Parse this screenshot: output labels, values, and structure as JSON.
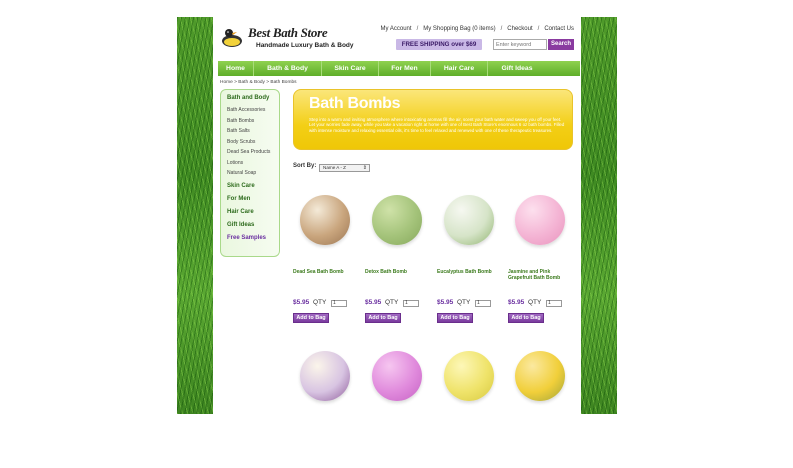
{
  "header": {
    "logo_name": "Best Bath Store",
    "logo_tagline": "Handmade Luxury Bath & Body",
    "links": [
      "My Account",
      "My Shopping Bag (0 items)",
      "Checkout",
      "Contact Us"
    ],
    "shipping_promo": "FREE SHIPPING over $69",
    "search_placeholder": "Enter keyword",
    "search_button": "Search"
  },
  "nav": [
    "Home",
    "Bath & Body",
    "Skin Care",
    "For Men",
    "Hair Care",
    "Gift Ideas"
  ],
  "breadcrumb": "Home > Bath & Body > Bath Bombs",
  "sidebar": {
    "section": "Bath and Body",
    "subitems": [
      "Bath Accessories",
      "Bath Bombs",
      "Bath Salts",
      "Body Scrubs",
      "Dead Sea Products",
      "Lotions",
      "Natural Soap"
    ],
    "sections": [
      "Skin Care",
      "For Men",
      "Hair Care",
      "Gift Ideas",
      "Free Samples"
    ]
  },
  "banner": {
    "title": "Bath Bombs",
    "description": "Step into a warm and inviting atmosphere where intoxicating aromas fill the air, scent your bath water and sweep you off your feet. Let your worries fade away, while you take a vacation right at home with one of Best Bath Store's enormous 6 oz bath bombs. Filled with intense moisture and relaxing essential oils, it's time to feel relaxed and renewed with one of these therapeutic treasures."
  },
  "sort": {
    "label": "Sort By:",
    "selected": "Name A - Z"
  },
  "products": [
    {
      "name": "Dead Sea Bath Bomb",
      "price": "$5.95",
      "qty_label": "QTY",
      "qty": "1",
      "button": "Add to Bag",
      "colors": [
        "#f4ead8",
        "#c9a57d",
        "#9a7552"
      ]
    },
    {
      "name": "Detox Bath Bomb",
      "price": "$5.95",
      "qty_label": "QTY",
      "qty": "1",
      "button": "Add to Bag",
      "colors": [
        "#cfe2a8",
        "#a4c37a",
        "#86a85c"
      ]
    },
    {
      "name": "Eucalyptus Bath Bomb",
      "price": "$5.95",
      "qty_label": "QTY",
      "qty": "1",
      "button": "Add to Bag",
      "colors": [
        "#f6f8f1",
        "#d6e4c8",
        "#8fb36e"
      ]
    },
    {
      "name": "Jasmine and Pink Grapefruit Bath Bomb",
      "price": "$5.95",
      "qty_label": "QTY",
      "qty": "1",
      "button": "Add to Bag",
      "colors": [
        "#fde0ee",
        "#f4b4d4",
        "#e993bd"
      ]
    },
    {
      "name": "",
      "price": "",
      "qty_label": "",
      "qty": "",
      "button": "",
      "colors": [
        "#fbf5ea",
        "#d8c4e2",
        "#8e5a9a"
      ]
    },
    {
      "name": "",
      "price": "",
      "qty_label": "",
      "qty": "",
      "button": "",
      "colors": [
        "#f6c6f0",
        "#e08adc",
        "#c662c4"
      ]
    },
    {
      "name": "",
      "price": "",
      "qty_label": "",
      "qty": "",
      "button": "",
      "colors": [
        "#fdf7b8",
        "#efe36a",
        "#d7c93f"
      ]
    },
    {
      "name": "",
      "price": "",
      "qty_label": "",
      "qty": "",
      "button": "",
      "colors": [
        "#fbe9a0",
        "#f1cf3a",
        "#9ea33a"
      ]
    }
  ]
}
